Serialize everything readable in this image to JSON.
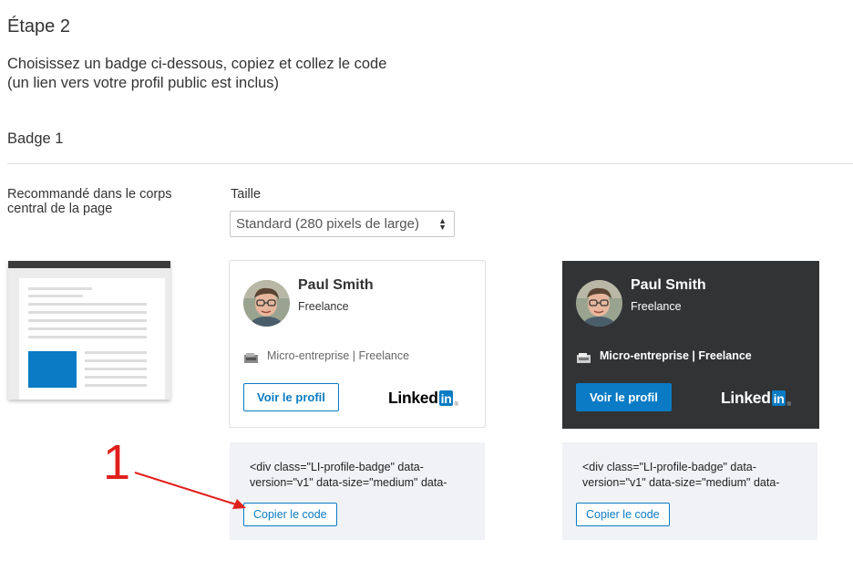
{
  "step": {
    "title": "Étape 2"
  },
  "instructions": {
    "line1": "Choisissez un badge ci-dessous, copiez et collez le code",
    "line2": "(un lien vers votre profil public est inclus)"
  },
  "badge_section": {
    "heading": "Badge 1",
    "placement": "Recommandé dans le corps central de la page",
    "size_label": "Taille",
    "size_selected": "Standard (280 pixels de large)"
  },
  "badges": [
    {
      "theme": "light",
      "name": "Paul Smith",
      "role": "Freelance",
      "company": "Micro-entreprise | Freelance",
      "view_button": "Voir le profil",
      "logo_text": "Linked",
      "logo_in": "in",
      "code_snippet": "<div class=\"LI-profile-badge\"  data-\nversion=\"v1\" data-size=\"medium\" data-",
      "copy_button": "Copier le code"
    },
    {
      "theme": "dark",
      "name": "Paul Smith",
      "role": "Freelance",
      "company": "Micro-entreprise | Freelance",
      "view_button": "Voir le profil",
      "logo_text": "Linked",
      "logo_in": "in",
      "code_snippet": "<div class=\"LI-profile-badge\"  data-\nversion=\"v1\" data-size=\"medium\" data-",
      "copy_button": "Copier le code"
    }
  ],
  "annotation": {
    "number": "1"
  },
  "colors": {
    "accent": "#0a7bc4",
    "dark_badge": "#313335",
    "code_bg": "#f0f2f5",
    "annotation": "#e0201c"
  },
  "icons": [
    "chevron-updown-icon",
    "company-icon",
    "linkedin-logo",
    "avatar-photo",
    "red-arrow"
  ]
}
